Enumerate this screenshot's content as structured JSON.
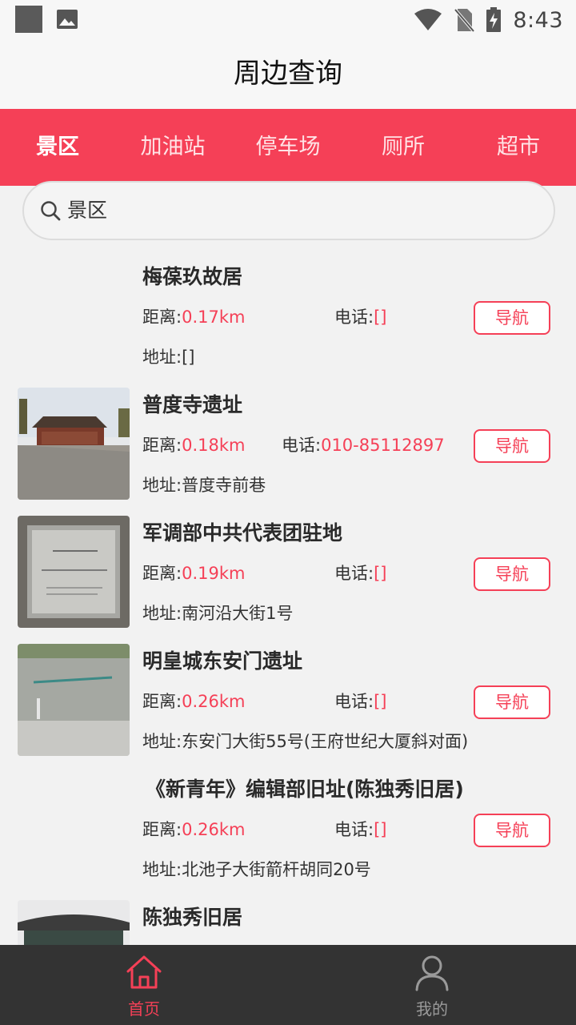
{
  "status_bar": {
    "time": "8:43"
  },
  "header": {
    "title": "周边查询"
  },
  "tabs": [
    {
      "label": "景区",
      "active": true
    },
    {
      "label": "加油站",
      "active": false
    },
    {
      "label": "停车场",
      "active": false
    },
    {
      "label": "厕所",
      "active": false
    },
    {
      "label": "超市",
      "active": false
    }
  ],
  "search": {
    "value": "景区"
  },
  "labels": {
    "distance": "距离:",
    "phone": "电话:",
    "address": "地址:",
    "navigate": "导航"
  },
  "places": [
    {
      "name": "梅葆玖故居",
      "distance": "0.17km",
      "phone": "[]",
      "address": "[]"
    },
    {
      "name": "普度寺遗址",
      "distance": "0.18km",
      "phone": "010-85112897",
      "address": "普度寺前巷"
    },
    {
      "name": "军调部中共代表团驻地",
      "distance": "0.19km",
      "phone": "[]",
      "address": "南河沿大街1号"
    },
    {
      "name": "明皇城东安门遗址",
      "distance": "0.26km",
      "phone": "[]",
      "address": "东安门大街55号(王府世纪大厦斜对面)"
    },
    {
      "name": "《新青年》编辑部旧址(陈独秀旧居)",
      "distance": "0.26km",
      "phone": "[]",
      "address": "北池子大街箭杆胡同20号"
    },
    {
      "name": "陈独秀旧居",
      "distance": "",
      "phone": "",
      "address": ""
    }
  ],
  "partial_label": "距",
  "bottom_nav": [
    {
      "label": "首页",
      "icon": "home-icon",
      "active": true
    },
    {
      "label": "我的",
      "icon": "person-icon",
      "active": false
    }
  ],
  "colors": {
    "accent": "#f54057",
    "nav_bg": "#333333"
  }
}
